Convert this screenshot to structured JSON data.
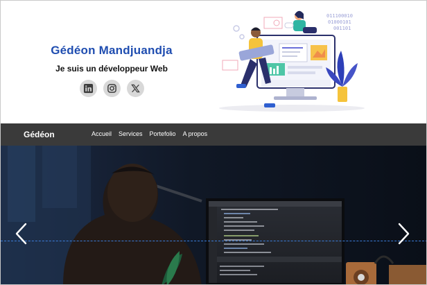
{
  "hero": {
    "name": "Gédéon Mandjuandja",
    "tagline": "Je suis un développeur Web",
    "socials": [
      {
        "icon": "linkedin-icon"
      },
      {
        "icon": "instagram-icon"
      },
      {
        "icon": "x-icon"
      }
    ],
    "illustration_code": [
      "011100010",
      "01000101",
      "001101"
    ]
  },
  "nav": {
    "brand": "Gédéon",
    "items": [
      "Accueil",
      "Services",
      "Portefolio",
      "A propos"
    ]
  },
  "slider": {
    "prev_icon": "chevron-left-icon",
    "next_icon": "chevron-right-icon"
  },
  "colors": {
    "name": "#1f4db0",
    "nav_bg": "#3a3a3a",
    "slider_bg": "#0d1320",
    "accent_guide": "#3b7ddb"
  }
}
